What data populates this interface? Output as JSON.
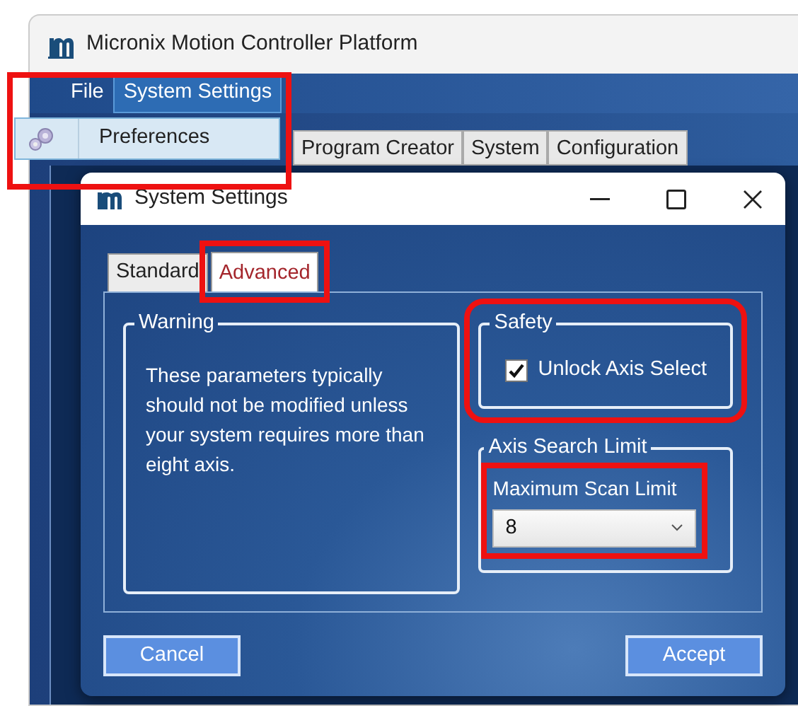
{
  "app": {
    "title": "Micronix Motion Controller Platform",
    "menu_highlighted": true,
    "menu": [
      {
        "label": "File",
        "selected": false
      },
      {
        "label": "System Settings",
        "selected": true
      }
    ],
    "menu_dropdown": [
      {
        "label": "Preferences"
      }
    ],
    "tabs": [
      {
        "label": "Program Creator"
      },
      {
        "label": "System"
      },
      {
        "label": "Configuration"
      }
    ]
  },
  "dialog": {
    "title": "System Settings",
    "tabs": [
      {
        "label": "Standard",
        "selected": false,
        "highlighted": false
      },
      {
        "label": "Advanced",
        "selected": true,
        "highlighted": true
      }
    ],
    "warning": {
      "title": "Warning",
      "text": "These parameters typically should not be modified unless your system requires more than eight axis."
    },
    "safety": {
      "title": "Safety",
      "highlighted": true,
      "checkbox": {
        "label": "Unlock Axis Select",
        "checked": true
      }
    },
    "axis_search_limit": {
      "title": "Axis Search Limit",
      "highlighted": true,
      "label": "Maximum Scan Limit",
      "value": "8"
    },
    "buttons": [
      "Cancel",
      "Accept"
    ]
  }
}
